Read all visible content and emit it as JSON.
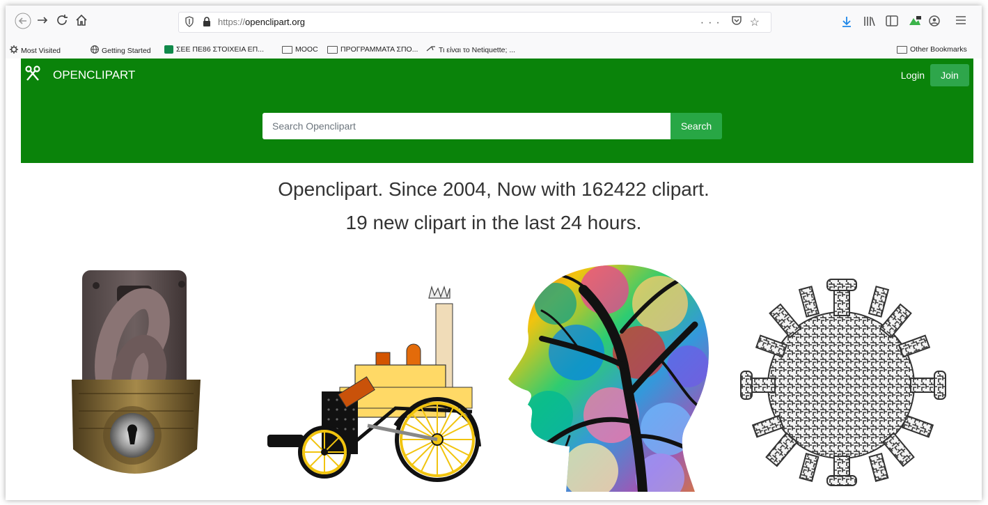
{
  "browser": {
    "url_scheme": "https://",
    "url_host": "openclipart.org",
    "url_menu": "···",
    "bookmarks": [
      {
        "label": "Most Visited",
        "icon": "gear-icon"
      },
      {
        "label": "Getting Started",
        "icon": "globe-icon"
      },
      {
        "label": "ΣΕΕ ΠΕ86 ΣΤΟΙΧΕΙΑ ΕΠ...",
        "icon": "sheet-icon"
      },
      {
        "label": "MOOC",
        "icon": "folder-icon"
      },
      {
        "label": "ΠΡΟΓΡΑΜΜΑΤΑ ΣΠΟ...",
        "icon": "folder-icon"
      },
      {
        "label": "Τι είναι το Netiquette; ...",
        "icon": "link-icon"
      }
    ],
    "other_bookmarks": "Other Bookmarks"
  },
  "header": {
    "brand": "OPENCLIPART",
    "login": "Login",
    "join": "Join"
  },
  "search": {
    "placeholder": "Search Openclipart",
    "button": "Search"
  },
  "headline": {
    "line1": "Openclipart. Since 2004, Now with 162422 clipart.",
    "line2": "19 new clipart in the last 24 hours."
  },
  "clipart": [
    {
      "name": "padlock-clipart"
    },
    {
      "name": "steam-locomotive-clipart"
    },
    {
      "name": "colorful-head-tree-clipart"
    },
    {
      "name": "maze-virus-clipart"
    }
  ],
  "colors": {
    "hero": "#0a830a",
    "search_button": "#28a745",
    "join_button": "#2ea64b"
  }
}
